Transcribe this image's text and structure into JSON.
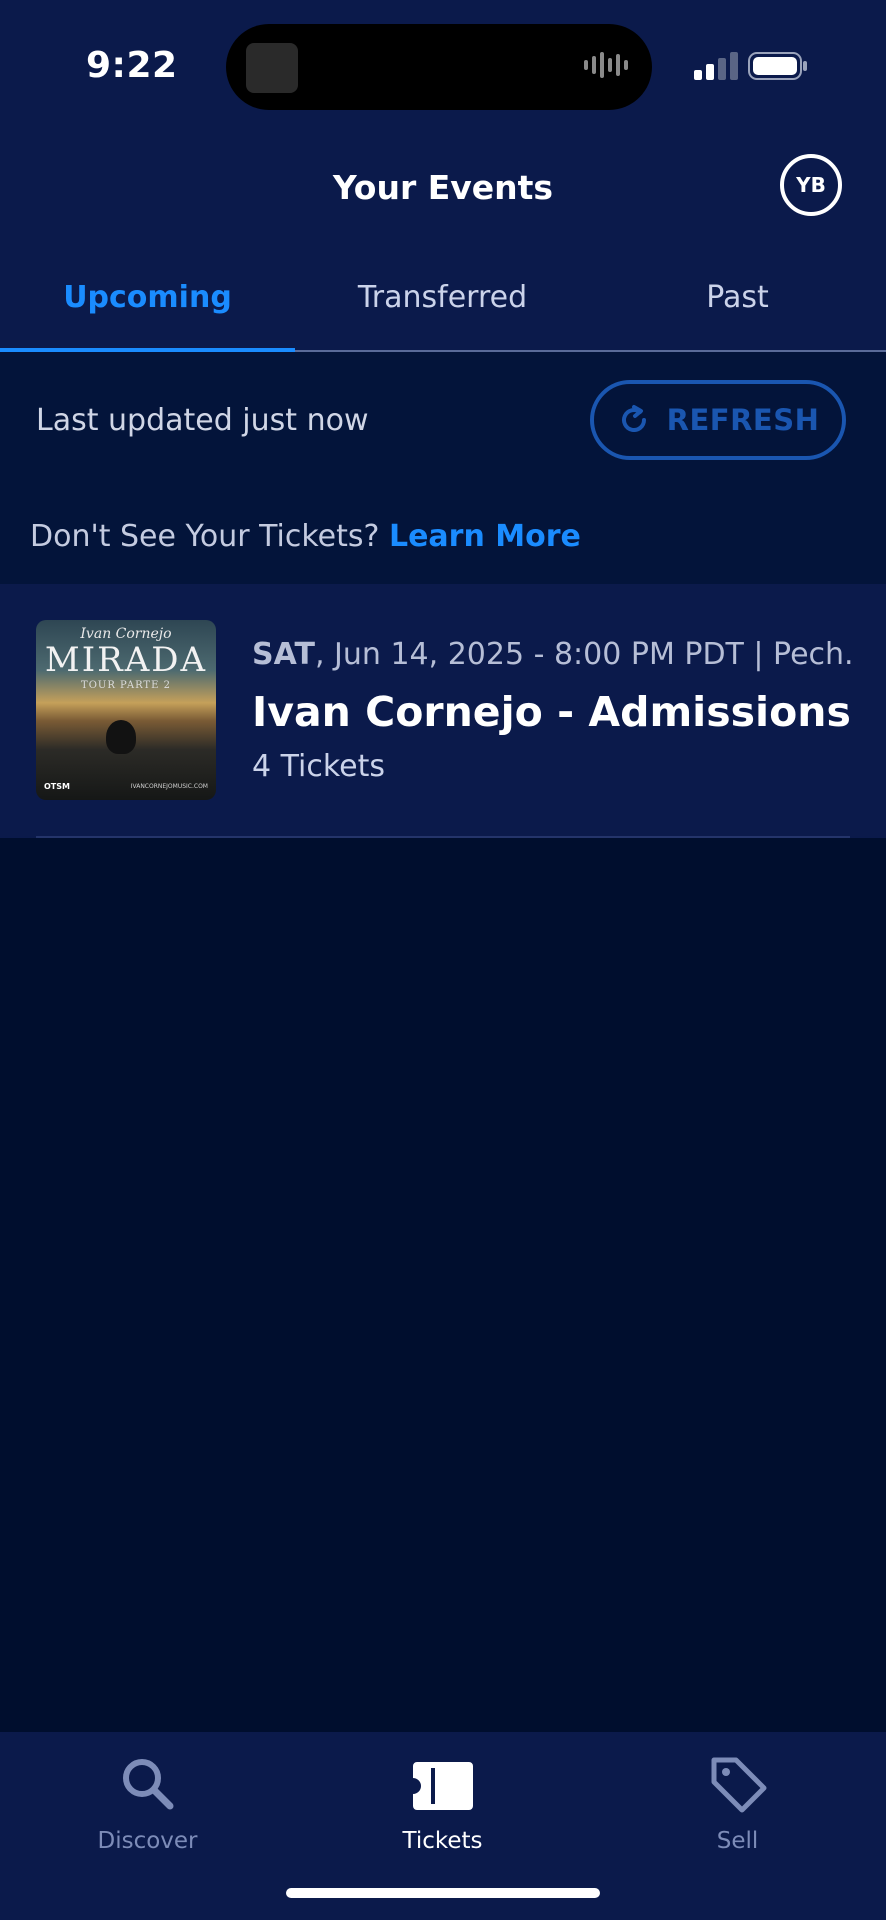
{
  "status_bar": {
    "time": "9:22"
  },
  "header": {
    "title": "Your Events",
    "avatar_initials": "YB"
  },
  "tabs": [
    {
      "label": "Upcoming",
      "active": true
    },
    {
      "label": "Transferred",
      "active": false
    },
    {
      "label": "Past",
      "active": false
    }
  ],
  "update_bar": {
    "last_updated": "Last updated just now",
    "refresh_label": "REFRESH",
    "refresh_icon": "refresh-icon"
  },
  "help": {
    "prompt": "Don't See Your Tickets?",
    "link": "Learn More"
  },
  "events": [
    {
      "day_of_week": "SAT",
      "meta_rest": ", Jun 14, 2025 - 8:00 PM PDT | Pech...",
      "title": "Ivan Cornejo - Admissions",
      "tickets": "4 Tickets",
      "thumbnail": {
        "artist": "Ivan Cornejo",
        "title": "MIRADA",
        "subtitle": "TOUR PARTE 2",
        "footer_left": "OTSM",
        "footer_right": "IVANCORNEJOMUSIC.COM"
      }
    }
  ],
  "bottom_nav": [
    {
      "label": "Discover",
      "icon": "search-icon",
      "active": false
    },
    {
      "label": "Tickets",
      "icon": "ticket-icon",
      "active": true
    },
    {
      "label": "Sell",
      "icon": "tag-icon",
      "active": false
    }
  ],
  "colors": {
    "background": "#000e2e",
    "header": "#0b1a4b",
    "accent": "#1a8cff",
    "refresh": "#1a56b0"
  }
}
